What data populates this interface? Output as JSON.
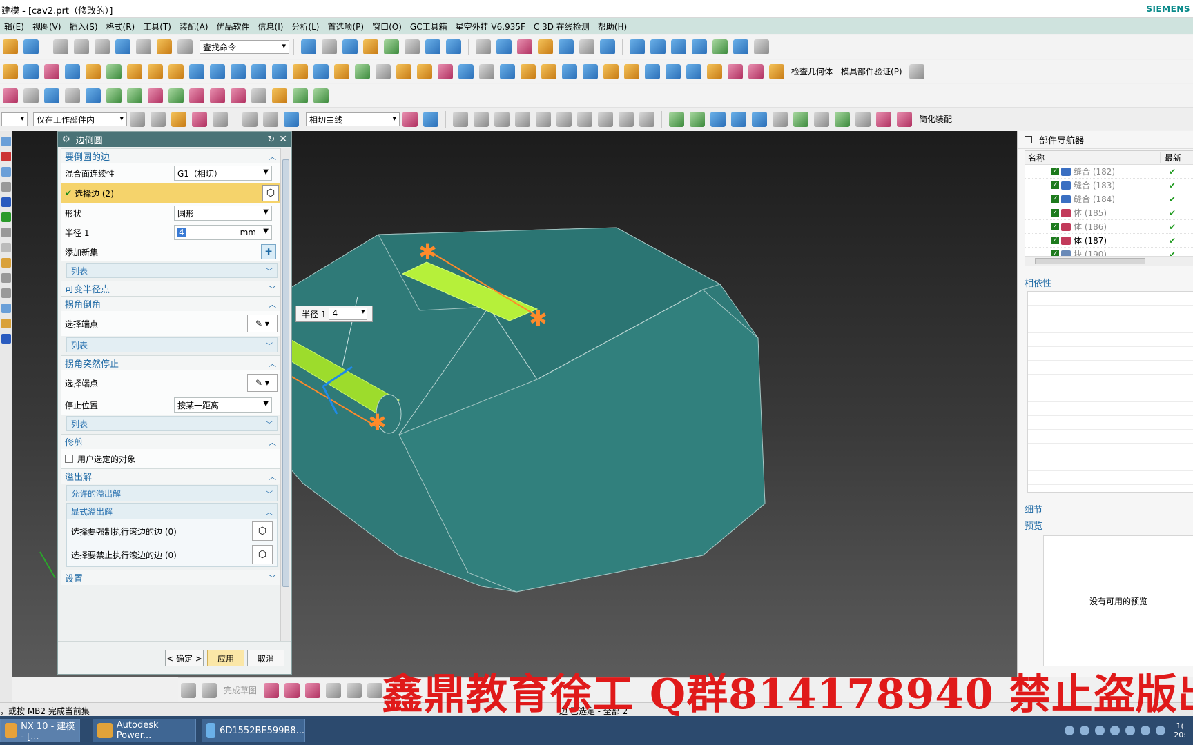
{
  "window": {
    "title": "建模 - [cav2.prt（修改的）]",
    "brand": "SIEMENS"
  },
  "menu": [
    "辑(E)",
    "视图(V)",
    "插入(S)",
    "格式(R)",
    "工具(T)",
    "装配(A)",
    "优品软件",
    "信息(I)",
    "分析(L)",
    "首选项(P)",
    "窗口(O)",
    "GC工具箱",
    "星空外挂 V6.935F",
    "C 3D 在线检测",
    "帮助(H)"
  ],
  "toolbar": {
    "search_placeholder": "查找命令",
    "check_geometry": "检查几何体",
    "mold_validate": "模具部件验证(P)",
    "scope": "仅在工作部件内",
    "curve_rule": "相切曲线",
    "simplify": "简化装配"
  },
  "dialog": {
    "title": "边倒圆",
    "sections": {
      "edges": "要倒圆的边",
      "variable": "可变半径点",
      "corner_setback": "拐角倒角",
      "corner_stop": "拐角突然停止",
      "trim": "修剪",
      "overflow": "溢出解",
      "settings": "设置"
    },
    "continuity_label": "混合面连续性",
    "continuity_value": "G1（相切）",
    "select_edge": "选择边 (2)",
    "shape_label": "形状",
    "shape_value": "圆形",
    "radius_label": "半径 1",
    "radius_value": "4",
    "radius_unit": "mm",
    "add_new_set": "添加新集",
    "list": "列表",
    "select_endpoint": "选择端点",
    "stop_position_label": "停止位置",
    "stop_position_value": "按某一距离",
    "user_selected": "用户选定的对象",
    "allowed_overflow": "允许的溢出解",
    "explicit_overflow": "显式溢出解",
    "force_roll": "选择要强制执行滚边的边 (0)",
    "prevent_roll": "选择要禁止执行滚边的边 (0)",
    "ok": "< 确定 >",
    "apply": "应用",
    "cancel": "取消"
  },
  "radius_popup": {
    "label": "半径 1",
    "value": "4"
  },
  "navigator": {
    "title": "部件导航器",
    "col_name": "名称",
    "col_latest": "最新",
    "rows": [
      {
        "name": "缝合 (182)",
        "dim": true,
        "icon_color": "#3a6fc2"
      },
      {
        "name": "缝合 (183)",
        "dim": true,
        "icon_color": "#3a6fc2"
      },
      {
        "name": "缝合 (184)",
        "dim": true,
        "icon_color": "#3a6fc2"
      },
      {
        "name": "体 (185)",
        "dim": true,
        "icon_color": "#c23a5a"
      },
      {
        "name": "体 (186)",
        "dim": true,
        "icon_color": "#c23a5a"
      },
      {
        "name": "体 (187)",
        "dim": false,
        "icon_color": "#c23a5a"
      },
      {
        "name": "块 (190)",
        "dim": true,
        "icon_color": "#6a8ab8"
      }
    ],
    "dependencies": "相依性",
    "details": "细节",
    "preview": "预览",
    "no_preview": "没有可用的预览"
  },
  "minibar": {
    "finish_sketch": "完成草图"
  },
  "status": {
    "left": "，或按 MB2 完成当前集",
    "center": "边 已选定 - 全部 2"
  },
  "taskbar": {
    "items": [
      "NX 10 - 建模 - [...",
      "Autodesk Power...",
      "6D1552BE599B8..."
    ],
    "clock_top": "1(",
    "clock_bottom": "20:"
  },
  "watermark": "鑫鼎教育徐工 Q群814178940 禁止盗版出",
  "colors": {
    "accent": "#4a7377",
    "selected": "#f5d36b",
    "model": "#2f7a78",
    "fillet": "#b6f03a",
    "edge_highlight": "#ff8a2a"
  }
}
